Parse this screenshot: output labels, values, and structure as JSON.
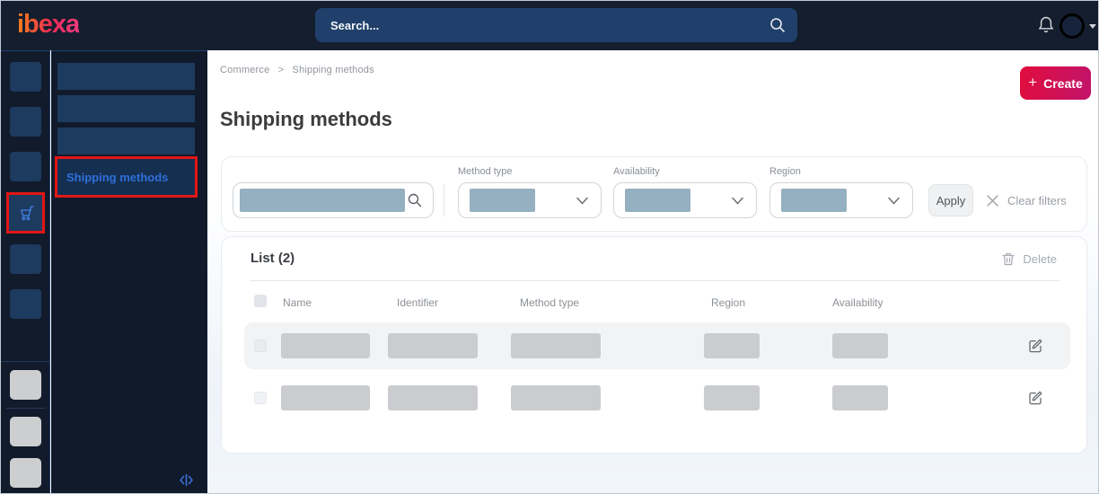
{
  "topbar": {
    "logo_text": "ibexa",
    "search_placeholder": "Search..."
  },
  "sidebar": {
    "active_icon": "shopping-cart",
    "highlight_color": "#e11616"
  },
  "menu_panel": {
    "active_item": "Shipping methods",
    "active_text_color": "#2f6fd9"
  },
  "breadcrumb": {
    "items": [
      "Commerce",
      "Shipping methods"
    ],
    "separator": ">"
  },
  "page": {
    "title": "Shipping methods"
  },
  "actions": {
    "create_plus": "+",
    "create_label": "Create",
    "create_gradient": [
      "#e00d3d",
      "#c2136b"
    ]
  },
  "filters": {
    "method_type_label": "Method type",
    "availability_label": "Availability",
    "region_label": "Region",
    "apply_label": "Apply",
    "clear_label": "Clear filters",
    "redaction_color": "#94b0c1"
  },
  "list": {
    "title": "List (2)",
    "delete_label": "Delete",
    "columns": [
      "Name",
      "Identifier",
      "Method type",
      "Region",
      "Availability"
    ],
    "row_count": 2,
    "rows_redacted": true
  },
  "icons": {
    "topbar": [
      "search-icon",
      "bell-icon",
      "avatar",
      "caret-down-icon"
    ],
    "filter": [
      "search-icon",
      "chevron-down-icon",
      "close-icon"
    ],
    "list": [
      "trash-icon",
      "edit-icon"
    ],
    "panel": [
      "collapse-panel-icon"
    ]
  }
}
